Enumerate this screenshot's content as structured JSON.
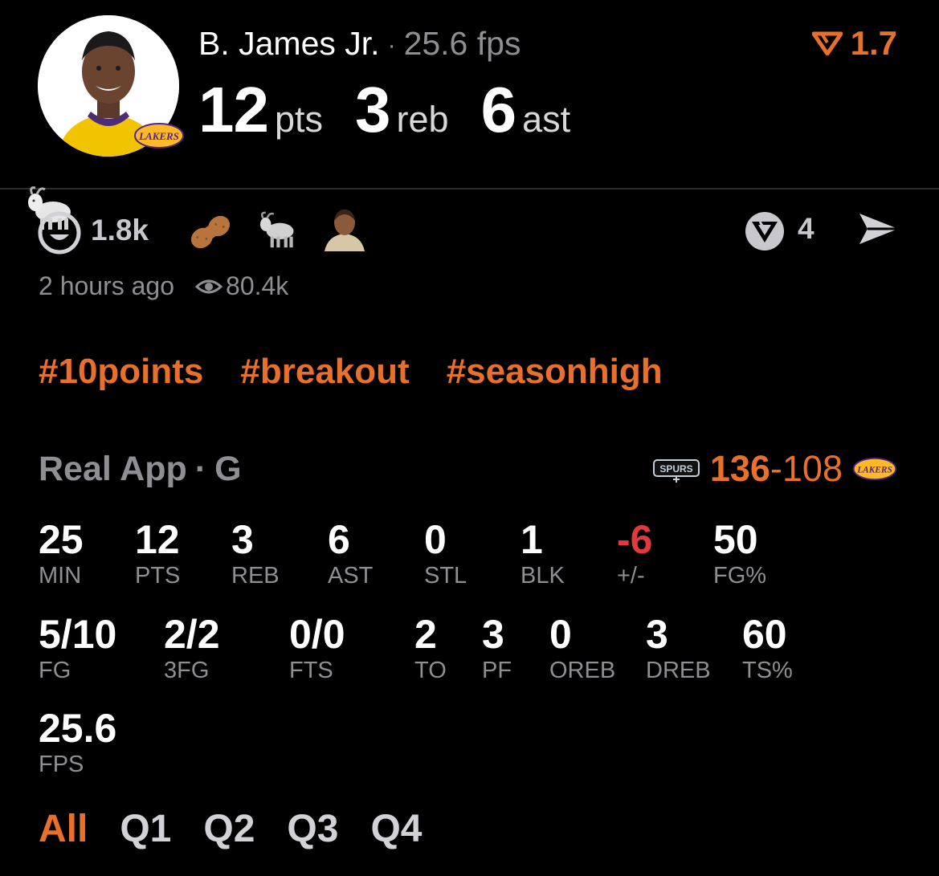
{
  "player": {
    "name": "B. James Jr.",
    "fps": "25.6 fps",
    "avatar_team_logo": "LAKERS",
    "pts": "12",
    "pts_unit": "pts",
    "reb": "3",
    "reb_unit": "reb",
    "ast": "6",
    "ast_unit": "ast"
  },
  "multiplier": {
    "value": "1.7",
    "icon": "v-chevron-icon",
    "color": "#e8702a"
  },
  "reactions": {
    "count": "1.8k",
    "items": [
      "goat-emoji",
      "smiley-icon",
      "peanut-emoji",
      "goat-emoji",
      "person-emoji"
    ],
    "replies": "4"
  },
  "meta": {
    "time": "2 hours ago",
    "views": "80.4k"
  },
  "hashtags": [
    "#10points",
    "#breakout",
    "#seasonhigh"
  ],
  "game": {
    "source": "Real App",
    "position": "G",
    "opponent_logo": "SPURS",
    "team_logo": "LAKERS",
    "score_left": "136",
    "score_right": "108"
  },
  "stats_row1": [
    {
      "v": "25",
      "l": "MIN"
    },
    {
      "v": "12",
      "l": "PTS"
    },
    {
      "v": "3",
      "l": "REB"
    },
    {
      "v": "6",
      "l": "AST"
    },
    {
      "v": "0",
      "l": "STL"
    },
    {
      "v": "1",
      "l": "BLK"
    },
    {
      "v": "-6",
      "l": "+/-"
    },
    {
      "v": "50",
      "l": "FG%"
    }
  ],
  "stats_row2": [
    {
      "v": "5/10",
      "l": "FG"
    },
    {
      "v": "2/2",
      "l": "3FG"
    },
    {
      "v": "0/0",
      "l": "FTS"
    },
    {
      "v": "2",
      "l": "TO"
    },
    {
      "v": "3",
      "l": "PF"
    },
    {
      "v": "0",
      "l": "OREB"
    },
    {
      "v": "3",
      "l": "DREB"
    },
    {
      "v": "60",
      "l": "TS%"
    }
  ],
  "stats_row3": [
    {
      "v": "25.6",
      "l": "FPS"
    }
  ],
  "tabs": [
    "All",
    "Q1",
    "Q2",
    "Q3",
    "Q4"
  ],
  "colors": {
    "accent": "#e8702a",
    "negative": "#e0393e",
    "muted": "#8e8e93"
  }
}
